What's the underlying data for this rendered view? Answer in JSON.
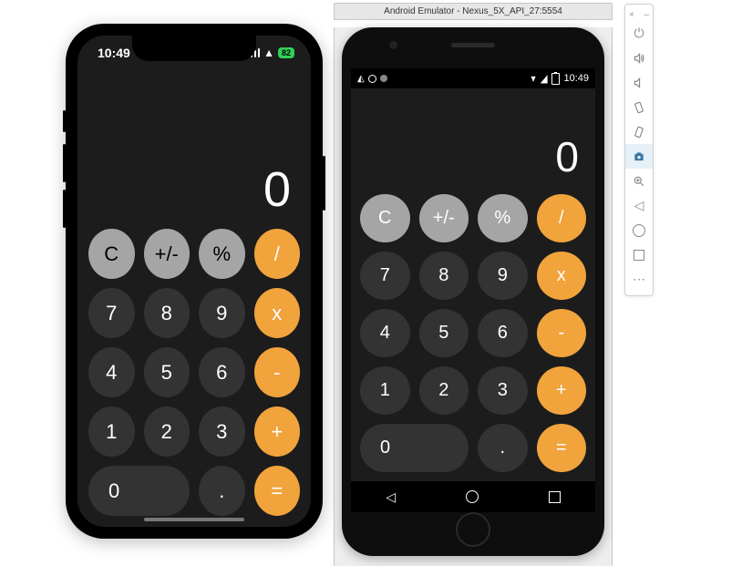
{
  "ios": {
    "status": {
      "time": "10:49",
      "battery_label": "82"
    },
    "calc": {
      "display": "0",
      "keys": {
        "clear": "C",
        "sign": "+/-",
        "percent": "%",
        "divide": "/",
        "n7": "7",
        "n8": "8",
        "n9": "9",
        "multiply": "x",
        "n4": "4",
        "n5": "5",
        "n6": "6",
        "minus": "-",
        "n1": "1",
        "n2": "2",
        "n3": "3",
        "plus": "+",
        "n0": "0",
        "dot": ".",
        "equals": "="
      }
    }
  },
  "android": {
    "emulator_title": "Android Emulator - Nexus_5X_API_27:5554",
    "status_time": "10:49",
    "calc": {
      "display": "0",
      "keys": {
        "clear": "C",
        "sign": "+/-",
        "percent": "%",
        "divide": "/",
        "n7": "7",
        "n8": "8",
        "n9": "9",
        "multiply": "x",
        "n4": "4",
        "n5": "5",
        "n6": "6",
        "minus": "-",
        "n1": "1",
        "n2": "2",
        "n3": "3",
        "plus": "+",
        "n0": "0",
        "dot": ".",
        "equals": "="
      }
    }
  },
  "toolbar": {
    "items": [
      {
        "name": "power-icon"
      },
      {
        "name": "volume-up-icon"
      },
      {
        "name": "volume-down-icon"
      },
      {
        "name": "rotate-left-icon"
      },
      {
        "name": "rotate-right-icon"
      },
      {
        "name": "camera-icon"
      },
      {
        "name": "zoom-in-icon"
      },
      {
        "name": "back-icon"
      },
      {
        "name": "home-icon"
      },
      {
        "name": "overview-icon"
      },
      {
        "name": "more-icon"
      }
    ]
  },
  "colors": {
    "op": "#f1a33c",
    "fn": "#a5a5a5",
    "num": "#333333",
    "bg": "#1c1c1c"
  }
}
